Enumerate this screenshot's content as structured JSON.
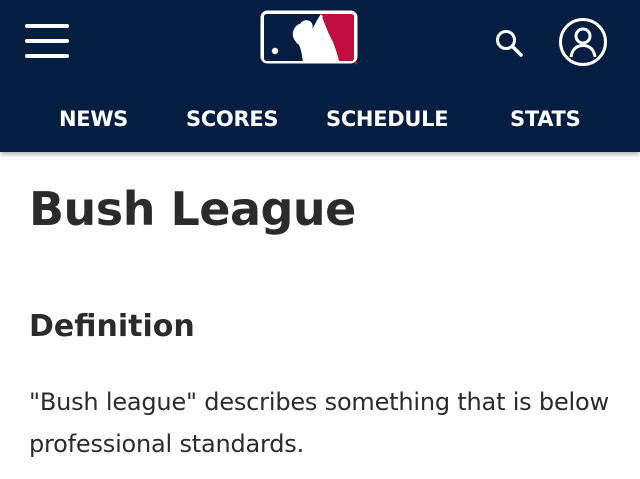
{
  "header": {
    "background_color": "#041e42",
    "logo_colors": {
      "blue": "#041e42",
      "red": "#bf0d3e",
      "white": "#ffffff"
    },
    "icons": {
      "menu": "hamburger-menu-icon",
      "search": "search-icon",
      "account": "account-icon"
    }
  },
  "nav": {
    "items": [
      {
        "label": "NEWS"
      },
      {
        "label": "SCORES"
      },
      {
        "label": "SCHEDULE"
      },
      {
        "label": "STATS"
      }
    ]
  },
  "article": {
    "title": "Bush League",
    "section_heading": "Definition",
    "body": "\"Bush league\" describes something that is below professional standards."
  }
}
